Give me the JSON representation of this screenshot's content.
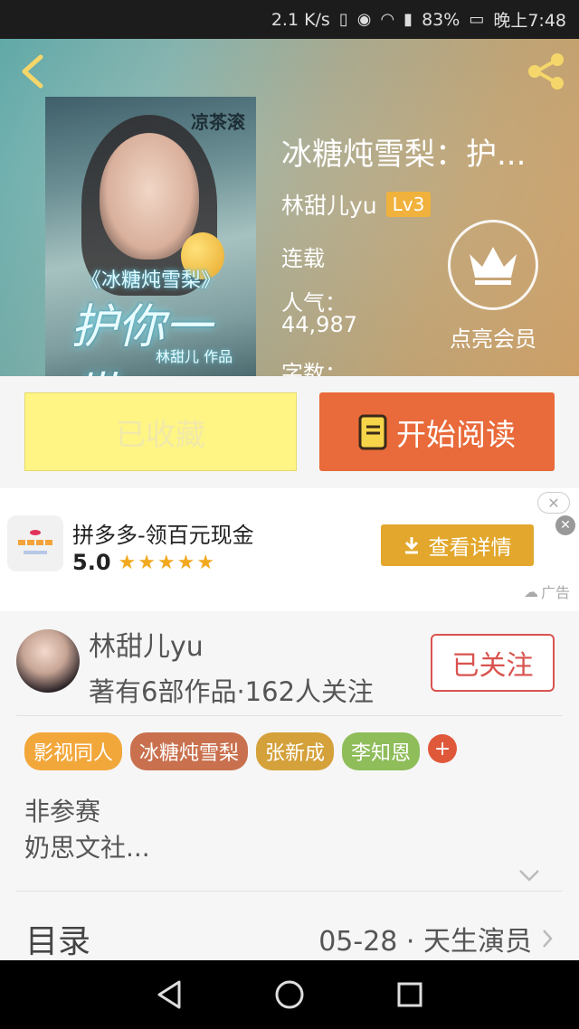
{
  "status_bar": {
    "network_speed": "2.1 K/s",
    "battery": "83%",
    "time": "晚上7:48"
  },
  "book": {
    "title": "冰糖炖雪梨：护...",
    "author": "林甜儿yu",
    "level": "Lv3",
    "status": "连载",
    "popularity_label": "人气：",
    "popularity_value": "44,987",
    "words_label": "字数：",
    "cover": {
      "stamp": "凉茶滚",
      "series_title": "《冰糖炖雪梨》",
      "main_text": "护你一世",
      "author_credit": "林甜儿 作品"
    }
  },
  "vip": {
    "label": "点亮会员",
    "icon": "crown-icon"
  },
  "actions": {
    "favorite_label": "已收藏",
    "read_label": "开始阅读"
  },
  "ad": {
    "title": "拼多多-领百元现金",
    "rating": "5.0",
    "stars": "★★★★★",
    "button_label": "查看详情",
    "tag": "广告"
  },
  "author_info": {
    "name": "林甜儿yu",
    "meta": "著有6部作品·162人关注",
    "follow_label": "已关注"
  },
  "tags": [
    {
      "label": "影视同人",
      "color": "#f2a73b"
    },
    {
      "label": "冰糖炖雪梨",
      "color": "#c9714f"
    },
    {
      "label": "张新成",
      "color": "#d4a13a"
    },
    {
      "label": "李知恩",
      "color": "#8fbd5a"
    }
  ],
  "tag_more": "+",
  "description": {
    "line1": "非参赛",
    "line2": "奶思文社..."
  },
  "toc": {
    "label": "目录",
    "latest": "05-28 · 天生演员"
  },
  "colors": {
    "accent_orange": "#e96a3a",
    "favorite_yellow": "#fff585",
    "follow_red": "#d9534f"
  }
}
